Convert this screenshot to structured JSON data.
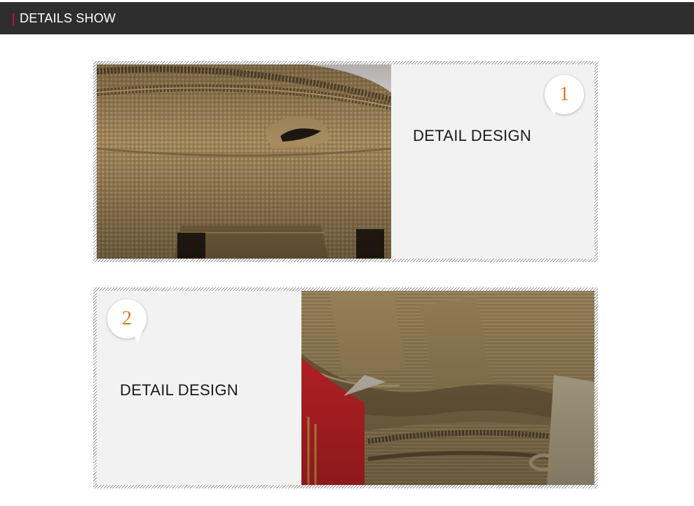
{
  "header": {
    "title": "DETAILS SHOW",
    "accent_color": "#c8102e",
    "background": "#2e2e2e"
  },
  "details": [
    {
      "number": "1",
      "label": "DETAIL DESIGN",
      "photo": "bag-zipper-pull-closeup",
      "number_color": "#e07a1f"
    },
    {
      "number": "2",
      "label": "DETAIL DESIGN",
      "photo": "bag-molle-webbing-closeup",
      "number_color": "#e07a1f"
    }
  ]
}
